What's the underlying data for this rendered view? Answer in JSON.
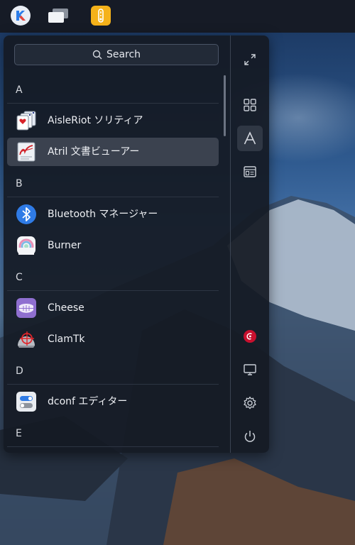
{
  "taskbar": {
    "icons": [
      {
        "name": "launcher-icon"
      },
      {
        "name": "multitasking-view-icon"
      },
      {
        "name": "file-manager-icon"
      }
    ]
  },
  "launcher": {
    "search": {
      "placeholder": "Search"
    },
    "sections": [
      {
        "letter": "A",
        "apps": [
          {
            "label": "AisleRiot ソリティア",
            "icon": "playing-cards-icon"
          },
          {
            "label": "Atril 文書ビューアー",
            "icon": "document-viewer-icon",
            "selected": true
          }
        ]
      },
      {
        "letter": "B",
        "apps": [
          {
            "label": "Bluetooth マネージャー",
            "icon": "bluetooth-icon"
          },
          {
            "label": "Burner",
            "icon": "disc-burner-icon"
          }
        ]
      },
      {
        "letter": "C",
        "apps": [
          {
            "label": "Cheese",
            "icon": "cheese-webcam-icon"
          },
          {
            "label": "ClamTk",
            "icon": "clamtk-antivirus-icon"
          }
        ]
      },
      {
        "letter": "D",
        "apps": [
          {
            "label": "dconf エディター",
            "icon": "dconf-editor-icon"
          }
        ]
      },
      {
        "letter": "E",
        "apps": []
      }
    ],
    "sidebar": [
      {
        "name": "fullscreen-icon"
      },
      {
        "name": "category-view-icon"
      },
      {
        "name": "alphabetical-view-icon",
        "active": true
      },
      {
        "name": "app-list-view-icon"
      },
      {
        "name": "debian-icon"
      },
      {
        "name": "computer-icon"
      },
      {
        "name": "settings-icon"
      },
      {
        "name": "power-icon"
      }
    ]
  },
  "colors": {
    "panel_bg": "#141a24",
    "selected_bg": "#3b424f",
    "accent_yellow": "#f5b21a"
  }
}
